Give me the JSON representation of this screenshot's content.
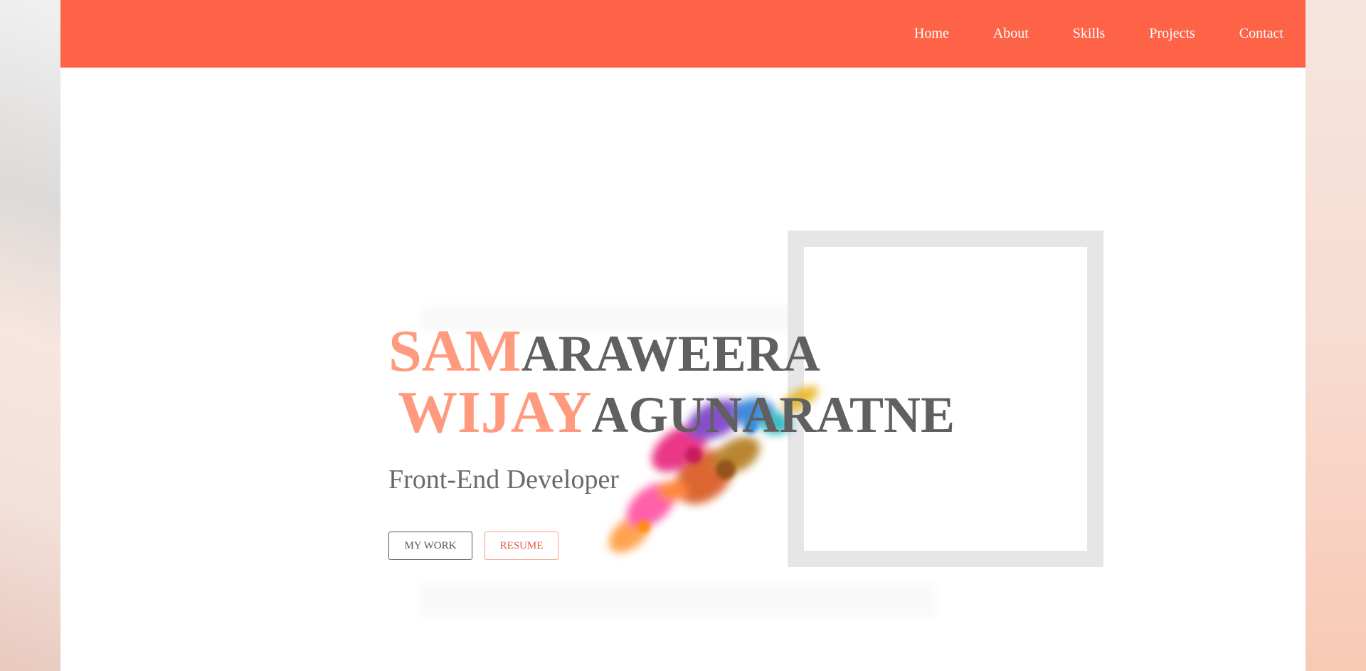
{
  "nav": {
    "items": [
      {
        "label": "Home"
      },
      {
        "label": "About"
      },
      {
        "label": "Skills"
      },
      {
        "label": "Projects"
      },
      {
        "label": "Contact"
      }
    ]
  },
  "hero": {
    "first_name_accent": "SAM",
    "first_name_rest": "ARAWEERA",
    "last_name_accent": "WIJAY",
    "last_name_rest": "AGUNARATNE",
    "subtitle": "Front-End Developer",
    "buttons": {
      "work": "MY WORK",
      "resume": "RESUME"
    }
  },
  "colors": {
    "nav_bg": "#ff6347",
    "accent_text": "#ff9a7e",
    "dark_text": "#606060",
    "frame": "#e6e6e6"
  },
  "icons": {
    "splash": "color-powder-splash-graphic"
  }
}
